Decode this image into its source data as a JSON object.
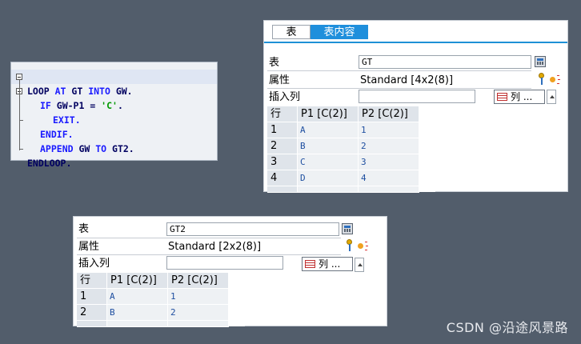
{
  "code": {
    "lines": [
      {
        "parts": [
          {
            "t": "LOOP ",
            "c": "id"
          },
          {
            "t": "AT ",
            "c": "kw"
          },
          {
            "t": "GT ",
            "c": "id"
          },
          {
            "t": "INTO ",
            "c": "kw"
          },
          {
            "t": "GW.",
            "c": "id"
          }
        ]
      },
      {
        "parts": [
          {
            "t": "IF ",
            "c": "kw"
          },
          {
            "t": "GW-P1 = ",
            "c": "id"
          },
          {
            "t": "'C'",
            "c": "str"
          },
          {
            "t": ".",
            "c": "id"
          }
        ]
      },
      {
        "parts": [
          {
            "t": "EXIT.",
            "c": "kw"
          }
        ]
      },
      {
        "parts": [
          {
            "t": "ENDIF.",
            "c": "kw"
          }
        ]
      },
      {
        "parts": [
          {
            "t": "APPEND ",
            "c": "kw"
          },
          {
            "t": "GW ",
            "c": "id"
          },
          {
            "t": "TO ",
            "c": "kw"
          },
          {
            "t": "GT2.",
            "c": "id"
          }
        ]
      },
      {
        "parts": [
          {
            "t": "ENDLOOP.",
            "c": "id"
          }
        ]
      }
    ]
  },
  "panel1": {
    "tabs": [
      {
        "label": "表"
      },
      {
        "label": "表内容"
      }
    ],
    "labels": {
      "table": "表",
      "attribute": "属性",
      "insert_col": "插入列"
    },
    "table_field_value": "GT",
    "attribute_value": "Standard [4x2(8)]",
    "insert_col_value": "",
    "columns_button": "列 ...",
    "grid": {
      "headers": [
        "行",
        "P1 [C(2)]",
        "P2 [C(2)]"
      ],
      "rows": [
        [
          "1",
          "A",
          "1"
        ],
        [
          "2",
          "B",
          "2"
        ],
        [
          "3",
          "C",
          "3"
        ],
        [
          "4",
          "D",
          "4"
        ]
      ]
    }
  },
  "panel2": {
    "labels": {
      "table": "表",
      "attribute": "属性",
      "insert_col": "插入列"
    },
    "table_field_value": "GT2",
    "attribute_value": "Standard [2x2(8)]",
    "insert_col_value": "",
    "columns_button": "列 ...",
    "grid": {
      "headers": [
        "行",
        "P1 [C(2)]",
        "P2 [C(2)]"
      ],
      "rows": [
        [
          "1",
          "A",
          "1"
        ],
        [
          "2",
          "B",
          "2"
        ]
      ]
    }
  },
  "watermark": "CSDN @沿途风景路",
  "colors": {
    "background": "#525d6b",
    "tab_active": "#1f8fdc",
    "keyword": "#1a1aff",
    "string": "#009900"
  }
}
